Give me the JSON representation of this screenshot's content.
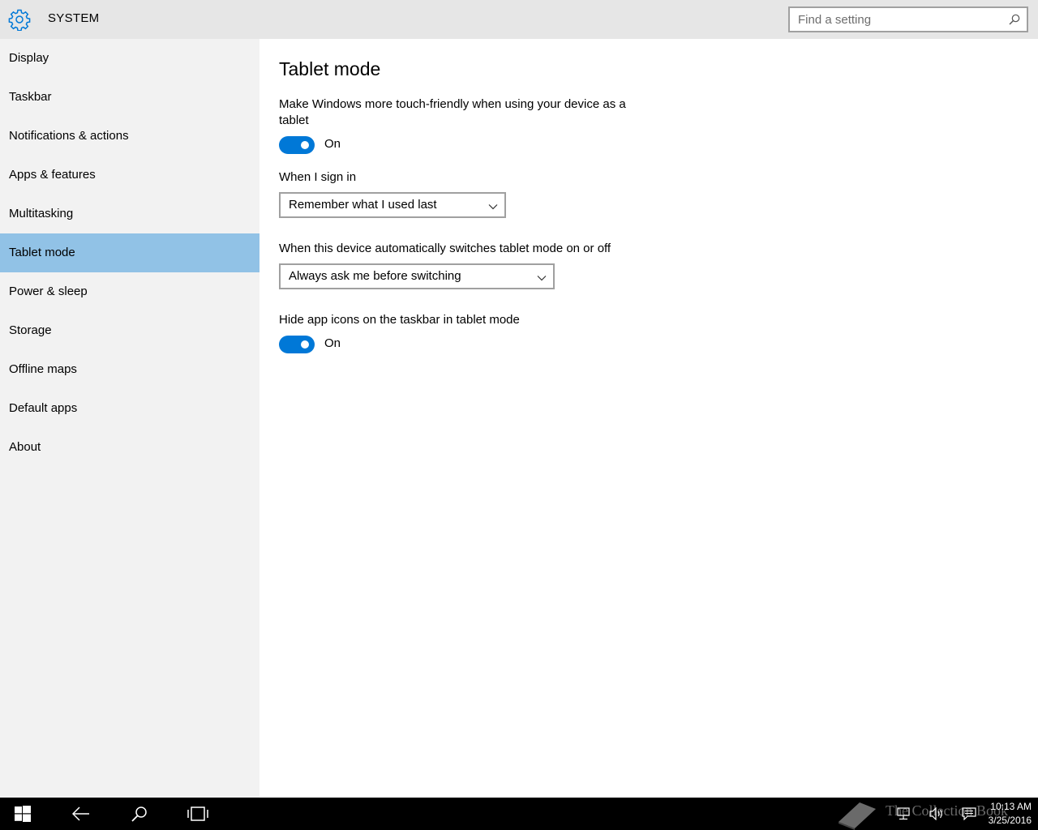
{
  "header": {
    "title": "SYSTEM",
    "search_placeholder": "Find a setting",
    "accent": "#0078d7"
  },
  "sidebar": {
    "items": [
      {
        "label": "Display"
      },
      {
        "label": "Taskbar"
      },
      {
        "label": "Notifications & actions"
      },
      {
        "label": "Apps & features"
      },
      {
        "label": "Multitasking"
      },
      {
        "label": "Tablet mode",
        "selected": true
      },
      {
        "label": "Power & sleep"
      },
      {
        "label": "Storage"
      },
      {
        "label": "Offline maps"
      },
      {
        "label": "Default apps"
      },
      {
        "label": "About"
      }
    ]
  },
  "main": {
    "title": "Tablet mode",
    "touch_friendly": {
      "label": "Make Windows more touch-friendly when using your device as a tablet",
      "state": "On"
    },
    "sign_in": {
      "label": "When I sign in",
      "value": "Remember what I used last"
    },
    "auto_switch": {
      "label": "When this device automatically switches tablet mode on or off",
      "value": "Always ask me before switching"
    },
    "hide_icons": {
      "label": "Hide app icons on the taskbar in tablet mode",
      "state": "On"
    }
  },
  "taskbar": {
    "time": "10:13 AM",
    "date": "3/25/2016",
    "watermark": "The Collection Book"
  }
}
